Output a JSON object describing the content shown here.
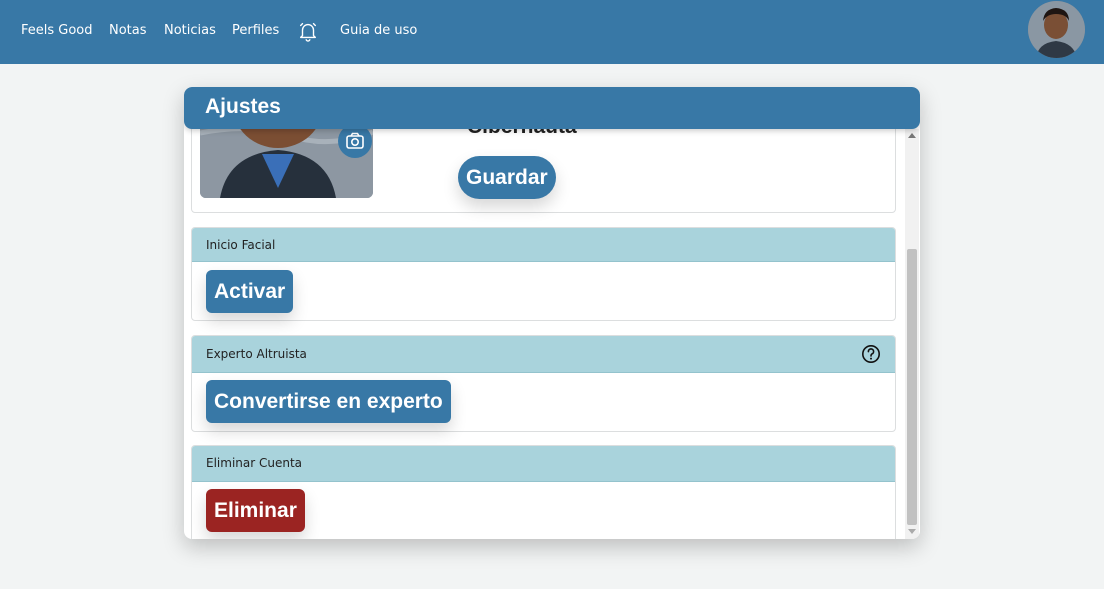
{
  "nav": {
    "brand": "Feels Good",
    "items": [
      "Notas",
      "Noticias",
      "Perfiles"
    ],
    "guide": "Guia de uso",
    "bell_icon": "bell-icon",
    "avatar_icon": "user-avatar"
  },
  "modal": {
    "title": "Ajustes",
    "profile": {
      "name_fragment": "Cibernauta",
      "save_label": "Guardar",
      "camera_icon": "camera-icon"
    },
    "sections": [
      {
        "title": "Inicio Facial",
        "button": "Activar"
      },
      {
        "title": "Experto Altruista",
        "button": "Convertirse en experto",
        "help_icon": "question-circle-icon"
      },
      {
        "title": "Eliminar Cuenta",
        "button": "Eliminar"
      }
    ]
  },
  "colors": {
    "primary": "#3878a6",
    "section_header": "#a9d3dc",
    "danger": "#9b2422",
    "background": "#f2f4f4"
  }
}
